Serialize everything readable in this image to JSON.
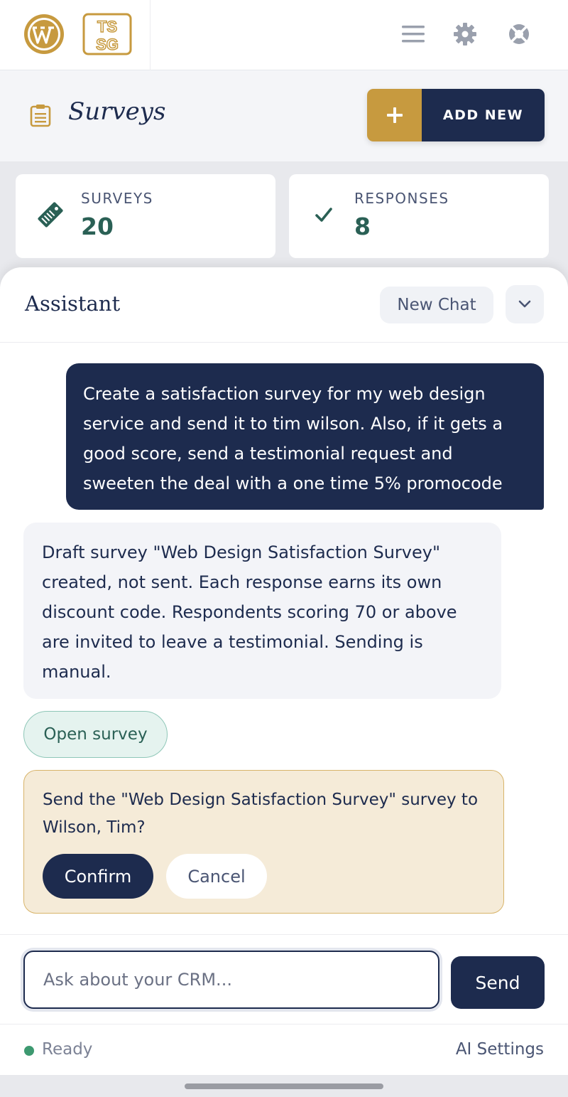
{
  "colors": {
    "navy": "#1d2b4e",
    "gold": "#c79a3f",
    "teal": "#2a6055",
    "status_green": "#3d9970"
  },
  "icons": {
    "logo_primary": "wordpress-logo",
    "logo_secondary": "tssg-logo",
    "menu": "hamburger-menu-icon",
    "settings": "gear-icon",
    "help": "lifebuoy-icon",
    "page": "clipboard-icon",
    "add": "plus-icon",
    "surveys_stat": "tag-icon",
    "responses_stat": "checkmark-icon",
    "collapse": "chevron-down-icon"
  },
  "logos": {
    "tssg_line1": "TS",
    "tssg_line2": "SG"
  },
  "header": {
    "page_title": "Surveys",
    "add_new_label": "ADD NEW"
  },
  "stats": {
    "surveys_label": "SURVEYS",
    "surveys_value": "20",
    "responses_label": "RESPONSES",
    "responses_value": "8"
  },
  "assistant": {
    "title": "Assistant",
    "new_chat_label": "New Chat",
    "user_message": "Create a satisfaction survey for my web design service and send it to tim wilson. Also, if it gets a good score, send a testimonial request and sweeten the deal with a one time 5% promocode",
    "bot_message": "Draft survey \"Web Design Satisfaction Survey\" created, not sent. Each response earns its own discount code. Respondents scoring 70 or above are invited to leave a testimonial. Sending is manual.",
    "open_survey_label": "Open survey",
    "confirm_prompt": "Send the \"Web Design Satisfaction Survey\" survey to Wilson, Tim?",
    "confirm_label": "Confirm",
    "cancel_label": "Cancel",
    "input_placeholder": "Ask about your CRM...",
    "input_value": "",
    "send_label": "Send",
    "status_text": "Ready",
    "ai_settings_label": "AI Settings"
  }
}
